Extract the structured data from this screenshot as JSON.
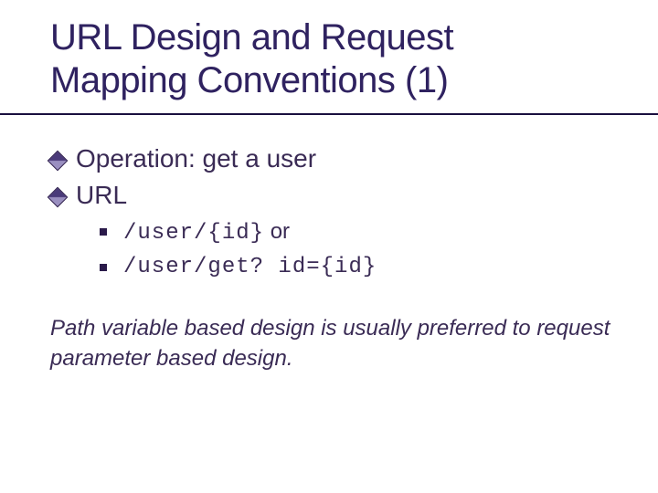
{
  "title": {
    "line1": "URL Design and Request",
    "line2": "Mapping Conventions (1)"
  },
  "bullets": {
    "operation": "Operation: get a user",
    "url_label": "URL",
    "url_option1_code": "/user/{id}",
    "url_option1_suffix": " or",
    "url_option2_code": "/user/get? id={id}"
  },
  "note": "Path variable based design is usually preferred to request parameter based design."
}
